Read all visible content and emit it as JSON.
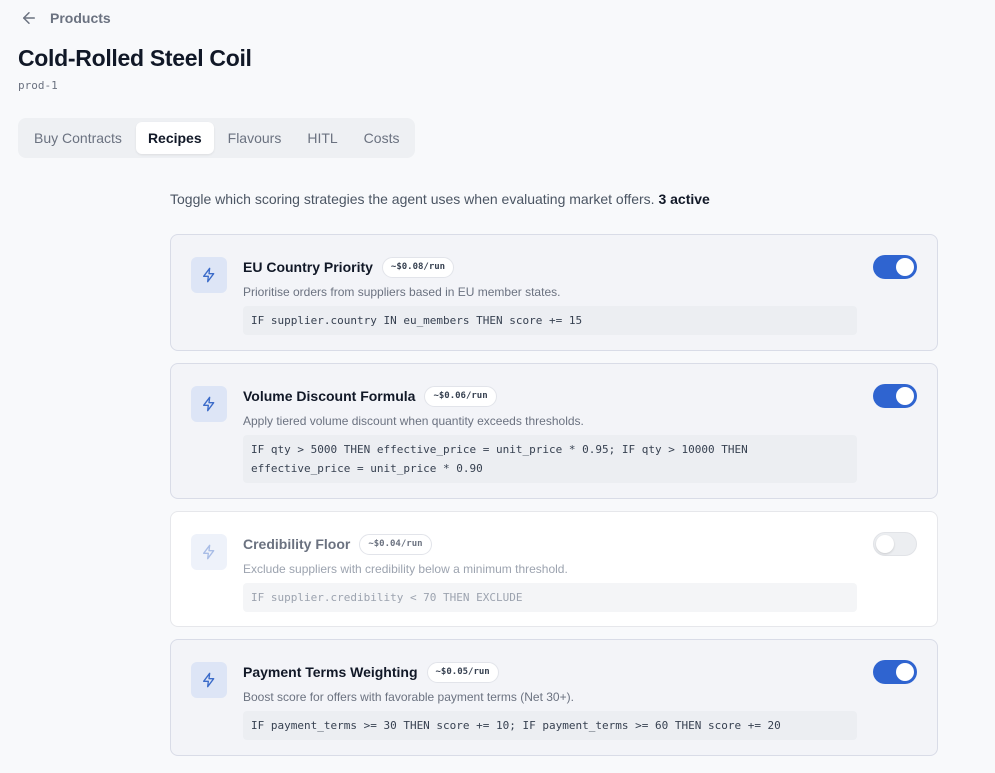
{
  "nav": {
    "back_label": "Products"
  },
  "product": {
    "title": "Cold-Rolled Steel Coil",
    "id": "prod-1"
  },
  "tabs": [
    {
      "label": "Buy Contracts",
      "active": false
    },
    {
      "label": "Recipes",
      "active": true
    },
    {
      "label": "Flavours",
      "active": false
    },
    {
      "label": "HITL",
      "active": false
    },
    {
      "label": "Costs",
      "active": false
    }
  ],
  "intro": {
    "text": "Toggle which scoring strategies the agent uses when evaluating market offers.",
    "active_count": "3 active"
  },
  "colors": {
    "accent": "#2f64d0",
    "icon": "#3b6bc9"
  },
  "recipes": [
    {
      "name": "EU Country Priority",
      "cost": "~$0.08/run",
      "description": "Prioritise orders from suppliers based in EU member states.",
      "code": "IF supplier.country IN eu_members THEN score += 15",
      "enabled": true,
      "icon": "bolt-icon"
    },
    {
      "name": "Volume Discount Formula",
      "cost": "~$0.06/run",
      "description": "Apply tiered volume discount when quantity exceeds thresholds.",
      "code": "IF qty > 5000 THEN effective_price = unit_price * 0.95; IF qty > 10000 THEN effective_price = unit_price * 0.90",
      "enabled": true,
      "icon": "bolt-icon"
    },
    {
      "name": "Credibility Floor",
      "cost": "~$0.04/run",
      "description": "Exclude suppliers with credibility below a minimum threshold.",
      "code": "IF supplier.credibility < 70 THEN EXCLUDE",
      "enabled": false,
      "icon": "bolt-icon"
    },
    {
      "name": "Payment Terms Weighting",
      "cost": "~$0.05/run",
      "description": "Boost score for offers with favorable payment terms (Net 30+).",
      "code": "IF payment_terms >= 30 THEN score += 10; IF payment_terms >= 60 THEN score += 20",
      "enabled": true,
      "icon": "bolt-icon"
    }
  ]
}
